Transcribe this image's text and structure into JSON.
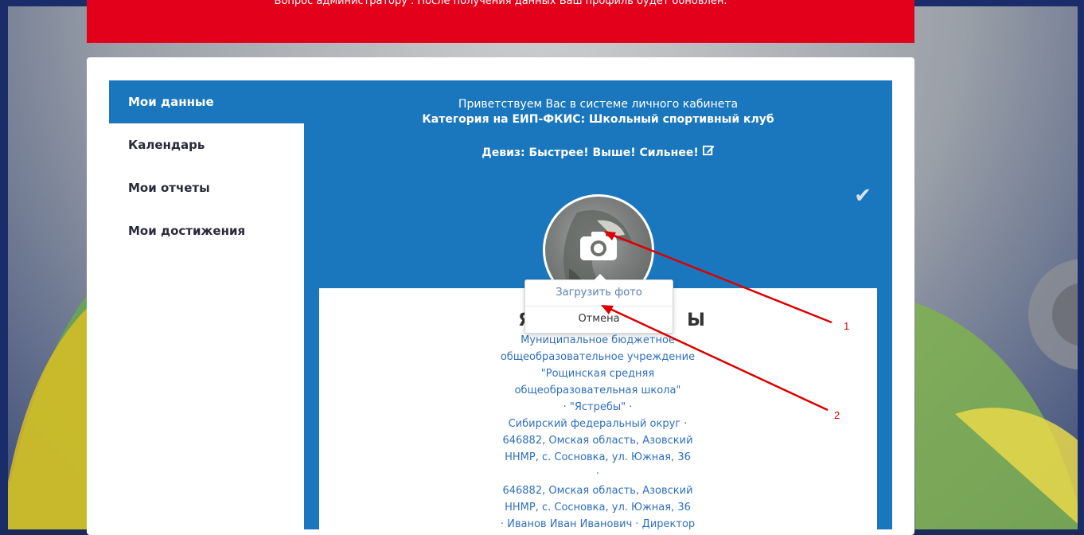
{
  "alert": {
    "text": "Вопрос администратору . После получения данных Ваш профиль будет обновлен."
  },
  "sidebar": {
    "items": [
      {
        "label": "Мои данные"
      },
      {
        "label": "Календарь"
      },
      {
        "label": "Мои отчеты"
      },
      {
        "label": "Мои достижения"
      }
    ]
  },
  "main": {
    "welcome": "Приветствуем Вас в системе личного кабинета",
    "category": "Категория на ЕИП-ФКИС: Школьный спортивный клуб",
    "motto": "Девиз: Быстрее! Выше! Сильнее!"
  },
  "photo_menu": {
    "upload": "Загрузить фото",
    "cancel": "Отмена"
  },
  "profile": {
    "lines": [
      "Муниципальное бюджетное",
      "общеобразовательное учреждение",
      "\"Рощинская средняя",
      "общеобразовательная школа\"",
      "· \"Ястребы\" ·",
      "Сибирский федеральный округ ·",
      "646882, Омская область, Азовский",
      "ННМР, с. Сосновка, ул. Южная, 36",
      "·",
      "646882, Омская область, Азовский",
      "ННМР, с. Сосновка, ул. Южная, 36",
      "· Иванов Иван Иванович · Директор"
    ]
  },
  "annotations": {
    "one": "1",
    "two": "2"
  },
  "colors": {
    "alert": "#e3001b",
    "primary": "#1a77bd",
    "arrow": "#dd0000"
  }
}
